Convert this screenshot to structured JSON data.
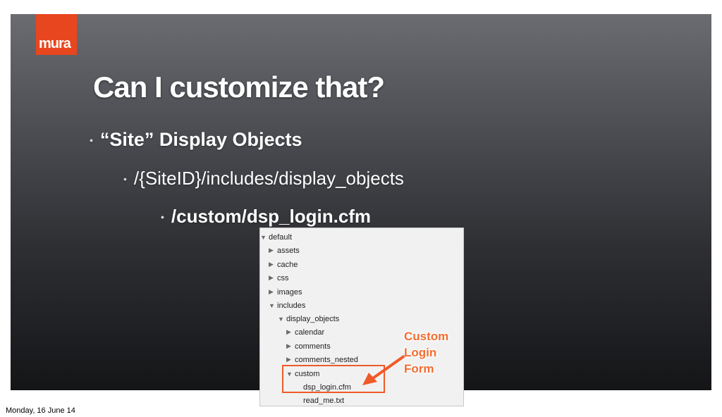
{
  "logo": {
    "text": "mura",
    "color": "#e8461f"
  },
  "slide": {
    "title": "Can I customize that?",
    "bullets": [
      "“Site” Display Objects",
      "/{SiteID}/includes/display_objects",
      "/custom/dsp_login.cfm"
    ]
  },
  "file_tree": {
    "items": [
      {
        "label": "default",
        "state": "expanded"
      },
      {
        "label": "assets",
        "state": "collapsed"
      },
      {
        "label": "cache",
        "state": "collapsed"
      },
      {
        "label": "css",
        "state": "collapsed"
      },
      {
        "label": "images",
        "state": "collapsed"
      },
      {
        "label": "includes",
        "state": "expanded"
      },
      {
        "label": "display_objects",
        "state": "expanded"
      },
      {
        "label": "calendar",
        "state": "collapsed"
      },
      {
        "label": "comments",
        "state": "collapsed"
      },
      {
        "label": "comments_nested",
        "state": "collapsed"
      },
      {
        "label": "custom",
        "state": "expanded"
      },
      {
        "label": "dsp_login.cfm",
        "state": "file"
      },
      {
        "label": "read_me.txt",
        "state": "file"
      }
    ]
  },
  "callout": {
    "lines": [
      "Custom",
      "Login",
      "Form"
    ],
    "color": "#f36b2f"
  },
  "footer": {
    "date": "Monday, 16 June 14"
  }
}
